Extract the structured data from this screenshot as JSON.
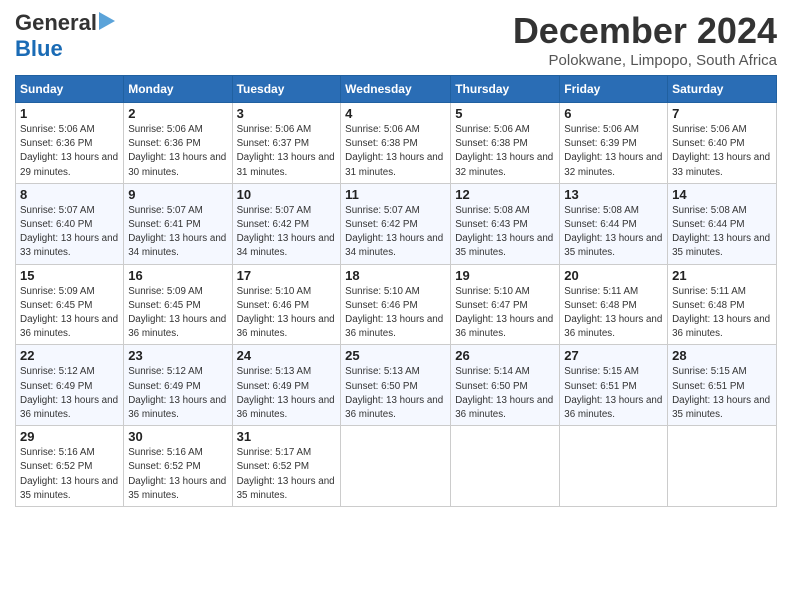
{
  "header": {
    "logo_general": "General",
    "logo_blue": "Blue",
    "month_title": "December 2024",
    "location": "Polokwane, Limpopo, South Africa"
  },
  "weekdays": [
    "Sunday",
    "Monday",
    "Tuesday",
    "Wednesday",
    "Thursday",
    "Friday",
    "Saturday"
  ],
  "weeks": [
    [
      {
        "day": "1",
        "sunrise": "5:06 AM",
        "sunset": "6:36 PM",
        "daylight": "13 hours and 29 minutes."
      },
      {
        "day": "2",
        "sunrise": "5:06 AM",
        "sunset": "6:36 PM",
        "daylight": "13 hours and 30 minutes."
      },
      {
        "day": "3",
        "sunrise": "5:06 AM",
        "sunset": "6:37 PM",
        "daylight": "13 hours and 31 minutes."
      },
      {
        "day": "4",
        "sunrise": "5:06 AM",
        "sunset": "6:38 PM",
        "daylight": "13 hours and 31 minutes."
      },
      {
        "day": "5",
        "sunrise": "5:06 AM",
        "sunset": "6:38 PM",
        "daylight": "13 hours and 32 minutes."
      },
      {
        "day": "6",
        "sunrise": "5:06 AM",
        "sunset": "6:39 PM",
        "daylight": "13 hours and 32 minutes."
      },
      {
        "day": "7",
        "sunrise": "5:06 AM",
        "sunset": "6:40 PM",
        "daylight": "13 hours and 33 minutes."
      }
    ],
    [
      {
        "day": "8",
        "sunrise": "5:07 AM",
        "sunset": "6:40 PM",
        "daylight": "13 hours and 33 minutes."
      },
      {
        "day": "9",
        "sunrise": "5:07 AM",
        "sunset": "6:41 PM",
        "daylight": "13 hours and 34 minutes."
      },
      {
        "day": "10",
        "sunrise": "5:07 AM",
        "sunset": "6:42 PM",
        "daylight": "13 hours and 34 minutes."
      },
      {
        "day": "11",
        "sunrise": "5:07 AM",
        "sunset": "6:42 PM",
        "daylight": "13 hours and 34 minutes."
      },
      {
        "day": "12",
        "sunrise": "5:08 AM",
        "sunset": "6:43 PM",
        "daylight": "13 hours and 35 minutes."
      },
      {
        "day": "13",
        "sunrise": "5:08 AM",
        "sunset": "6:44 PM",
        "daylight": "13 hours and 35 minutes."
      },
      {
        "day": "14",
        "sunrise": "5:08 AM",
        "sunset": "6:44 PM",
        "daylight": "13 hours and 35 minutes."
      }
    ],
    [
      {
        "day": "15",
        "sunrise": "5:09 AM",
        "sunset": "6:45 PM",
        "daylight": "13 hours and 36 minutes."
      },
      {
        "day": "16",
        "sunrise": "5:09 AM",
        "sunset": "6:45 PM",
        "daylight": "13 hours and 36 minutes."
      },
      {
        "day": "17",
        "sunrise": "5:10 AM",
        "sunset": "6:46 PM",
        "daylight": "13 hours and 36 minutes."
      },
      {
        "day": "18",
        "sunrise": "5:10 AM",
        "sunset": "6:46 PM",
        "daylight": "13 hours and 36 minutes."
      },
      {
        "day": "19",
        "sunrise": "5:10 AM",
        "sunset": "6:47 PM",
        "daylight": "13 hours and 36 minutes."
      },
      {
        "day": "20",
        "sunrise": "5:11 AM",
        "sunset": "6:48 PM",
        "daylight": "13 hours and 36 minutes."
      },
      {
        "day": "21",
        "sunrise": "5:11 AM",
        "sunset": "6:48 PM",
        "daylight": "13 hours and 36 minutes."
      }
    ],
    [
      {
        "day": "22",
        "sunrise": "5:12 AM",
        "sunset": "6:49 PM",
        "daylight": "13 hours and 36 minutes."
      },
      {
        "day": "23",
        "sunrise": "5:12 AM",
        "sunset": "6:49 PM",
        "daylight": "13 hours and 36 minutes."
      },
      {
        "day": "24",
        "sunrise": "5:13 AM",
        "sunset": "6:49 PM",
        "daylight": "13 hours and 36 minutes."
      },
      {
        "day": "25",
        "sunrise": "5:13 AM",
        "sunset": "6:50 PM",
        "daylight": "13 hours and 36 minutes."
      },
      {
        "day": "26",
        "sunrise": "5:14 AM",
        "sunset": "6:50 PM",
        "daylight": "13 hours and 36 minutes."
      },
      {
        "day": "27",
        "sunrise": "5:15 AM",
        "sunset": "6:51 PM",
        "daylight": "13 hours and 36 minutes."
      },
      {
        "day": "28",
        "sunrise": "5:15 AM",
        "sunset": "6:51 PM",
        "daylight": "13 hours and 35 minutes."
      }
    ],
    [
      {
        "day": "29",
        "sunrise": "5:16 AM",
        "sunset": "6:52 PM",
        "daylight": "13 hours and 35 minutes."
      },
      {
        "day": "30",
        "sunrise": "5:16 AM",
        "sunset": "6:52 PM",
        "daylight": "13 hours and 35 minutes."
      },
      {
        "day": "31",
        "sunrise": "5:17 AM",
        "sunset": "6:52 PM",
        "daylight": "13 hours and 35 minutes."
      },
      null,
      null,
      null,
      null
    ]
  ]
}
